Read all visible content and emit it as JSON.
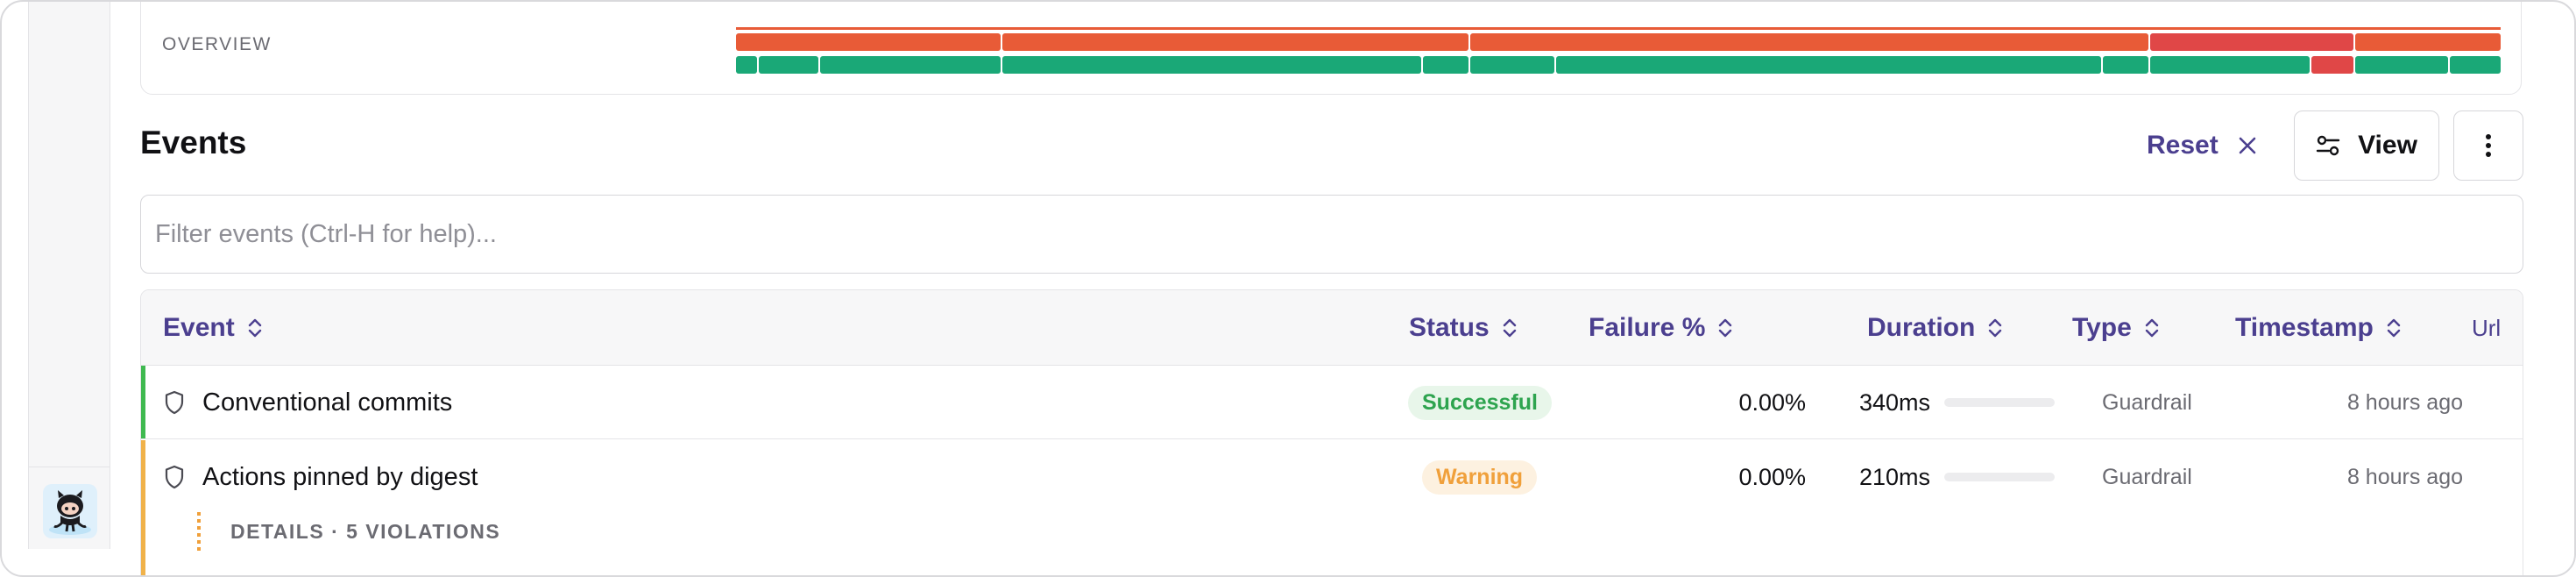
{
  "overview": {
    "label": "OVERVIEW",
    "colors": {
      "orange": "#e85b37",
      "red": "#e04747",
      "green": "#1aa877"
    }
  },
  "events": {
    "title": "Events",
    "reset_label": "Reset",
    "view_label": "View",
    "filter_placeholder": "Filter events (Ctrl-H for help)...",
    "columns": {
      "event": "Event",
      "status": "Status",
      "failure": "Failure %",
      "duration": "Duration",
      "type": "Type",
      "timestamp": "Timestamp",
      "url": "Url"
    },
    "rows": [
      {
        "name": "Conventional commits",
        "status": "Successful",
        "failure": "0.00%",
        "duration": "340ms",
        "duration_fraction": 0,
        "type": "Guardrail",
        "timestamp": "8 hours ago",
        "accent": "#3fb950"
      },
      {
        "name": "Actions pinned by digest",
        "status": "Warning",
        "failure": "0.00%",
        "duration": "210ms",
        "duration_fraction": 0,
        "type": "Guardrail",
        "timestamp": "8 hours ago",
        "accent": "#f0b24a",
        "details": "DETAILS · 5 VIOLATIONS"
      }
    ]
  },
  "icons": {
    "sort": "sort-icon",
    "close": "close-icon",
    "view": "sliders-icon",
    "more": "vertical-dots-icon",
    "shield": "shield-icon",
    "avatar": "octocat-avatar"
  }
}
